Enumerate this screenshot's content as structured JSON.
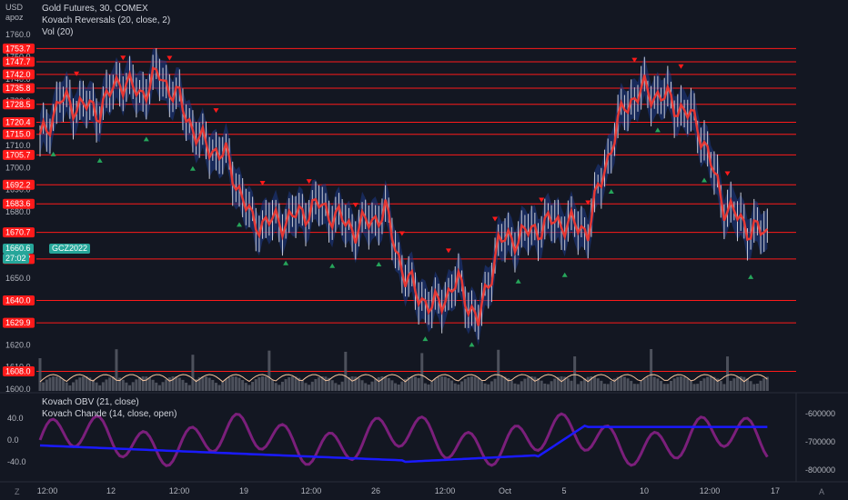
{
  "topleft": {
    "currency": "USD",
    "scale_mode": "apoz"
  },
  "legend": {
    "symbol": "Gold Futures, 30, COMEX",
    "indicator1": "Kovach Reversals (20, close, 2)",
    "indicator2": "Vol (20)",
    "osc1": "Kovach OBV (21, close)",
    "osc2": "Kovach Chande (14, close, open)"
  },
  "price_axis": {
    "ticks": [
      "1760.0",
      "1750.0",
      "1740.0",
      "1730.0",
      "1720.0",
      "1710.0",
      "1700.0",
      "1690.0",
      "1680.0",
      "1670.0",
      "1660.0",
      "1650.0",
      "1640.0",
      "1630.0",
      "1620.0",
      "1610.0",
      "1600.0"
    ],
    "levels": [
      "1753.7",
      "1747.7",
      "1742.0",
      "1735.8",
      "1728.5",
      "1720.4",
      "1715.0",
      "1705.7",
      "1692.2",
      "1683.6",
      "1670.7",
      "1658.7",
      "1640.0",
      "1629.9",
      "1608.0"
    ],
    "current_price": "1660.6",
    "countdown": "27:02",
    "ticker_tag": "GCZ2022"
  },
  "osc_axis_left": {
    "ticks": [
      "40.0",
      "0.0",
      "-40.0"
    ]
  },
  "osc_axis_right": {
    "ticks": [
      "-600000",
      "-700000",
      "-800000"
    ]
  },
  "time_axis": {
    "labels": [
      "12:00",
      "12",
      "12:00",
      "19",
      "12:00",
      "26",
      "12:00",
      "Oct",
      "5",
      "10",
      "12:00",
      "17"
    ]
  },
  "footer": {
    "left_button": "Z",
    "right_button": "A"
  },
  "colors": {
    "background": "#131722",
    "level_line": "#ff1a1a",
    "ma_line": "#e53935",
    "band": "#1e3a8a",
    "obv": "#1a1aff",
    "chande": "#7b1f7b",
    "up_marker": "#26a65b",
    "down_marker": "#ff1a1a",
    "ticker": "#26a69a"
  }
}
